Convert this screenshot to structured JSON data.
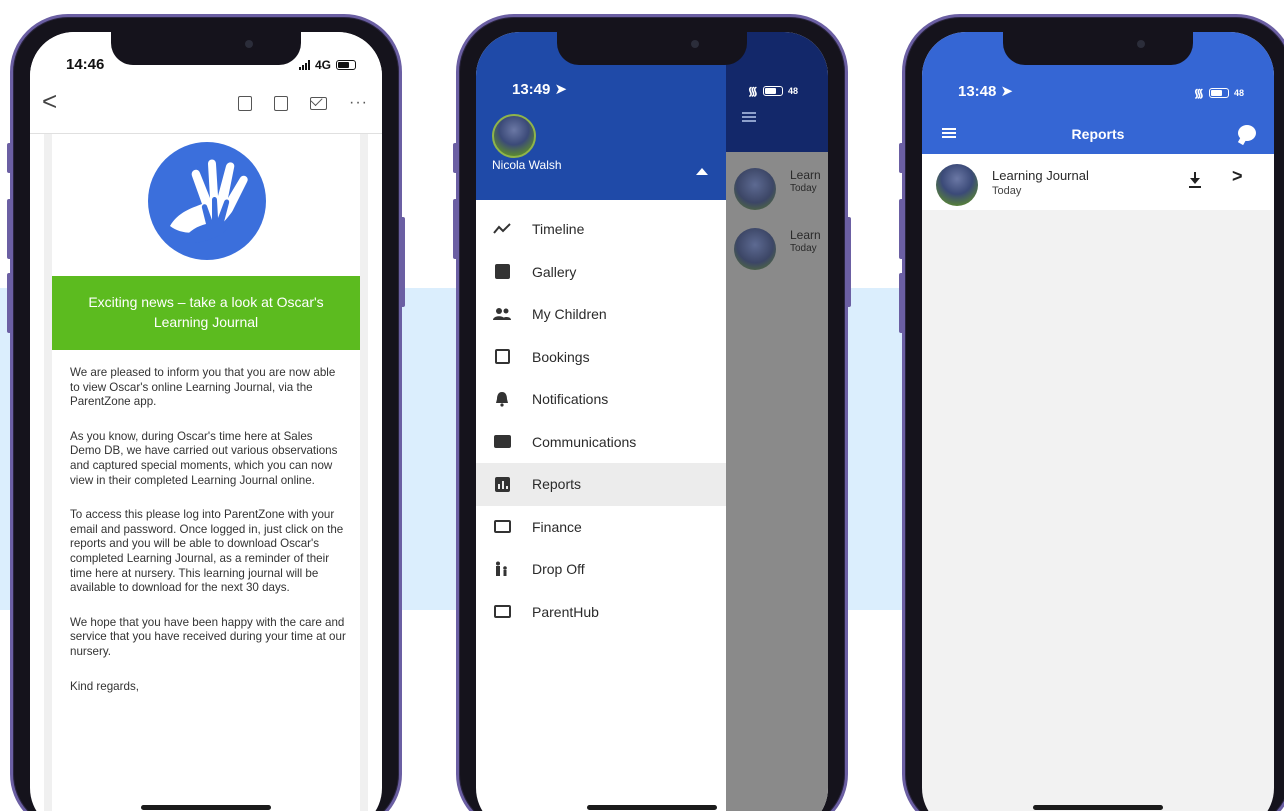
{
  "phone1": {
    "status": {
      "time": "14:46",
      "network": "4G"
    },
    "banner": "Exciting news – take a look at Oscar's Learning Journal",
    "paragraphs": [
      "We are pleased to inform you that you are now able to view Oscar's online Learning Journal, via the ParentZone app.",
      "As you know, during Oscar's time here at Sales Demo DB, we have carried out various observations and captured special moments, which you can now view in their completed Learning Journal online.",
      "To access this please log into ParentZone with your email and password. Once logged in, just click on the reports and you will be able to download Oscar's completed Learning Journal, as a reminder of their time here at nursery. This learning journal will be available to download for the next 30 days.",
      "We hope that you have been happy with the care and service that you have received during your time at our nursery.",
      "Kind regards,"
    ],
    "toolbar": {
      "back": "<",
      "more": "···"
    },
    "colors": {
      "banner": "#5cbb1f",
      "logo": "#3b6fdc"
    }
  },
  "phone2": {
    "status": {
      "time": "13:49",
      "battery": "48"
    },
    "user_name": "Nicola Walsh",
    "menu": [
      {
        "label": "Timeline",
        "icon": "timeline-icon"
      },
      {
        "label": "Gallery",
        "icon": "gallery-icon"
      },
      {
        "label": "My Children",
        "icon": "children-icon"
      },
      {
        "label": "Bookings",
        "icon": "calendar-icon"
      },
      {
        "label": "Notifications",
        "icon": "bell-icon"
      },
      {
        "label": "Communications",
        "icon": "mail-icon"
      },
      {
        "label": "Reports",
        "icon": "reports-icon",
        "active": true
      },
      {
        "label": "Finance",
        "icon": "card-icon"
      },
      {
        "label": "Drop Off",
        "icon": "family-icon"
      },
      {
        "label": "ParentHub",
        "icon": "hub-icon"
      }
    ],
    "behind": [
      {
        "title": "Learn",
        "sub": "Today"
      },
      {
        "title": "Learn",
        "sub": "Today"
      }
    ],
    "colors": {
      "drawer_header": "#1f4aa8"
    }
  },
  "phone3": {
    "status": {
      "time": "13:48",
      "battery": "48"
    },
    "title": "Reports",
    "reports": [
      {
        "title": "Learning Journal",
        "date": "Today"
      }
    ],
    "colors": {
      "header": "#3566d4"
    }
  }
}
